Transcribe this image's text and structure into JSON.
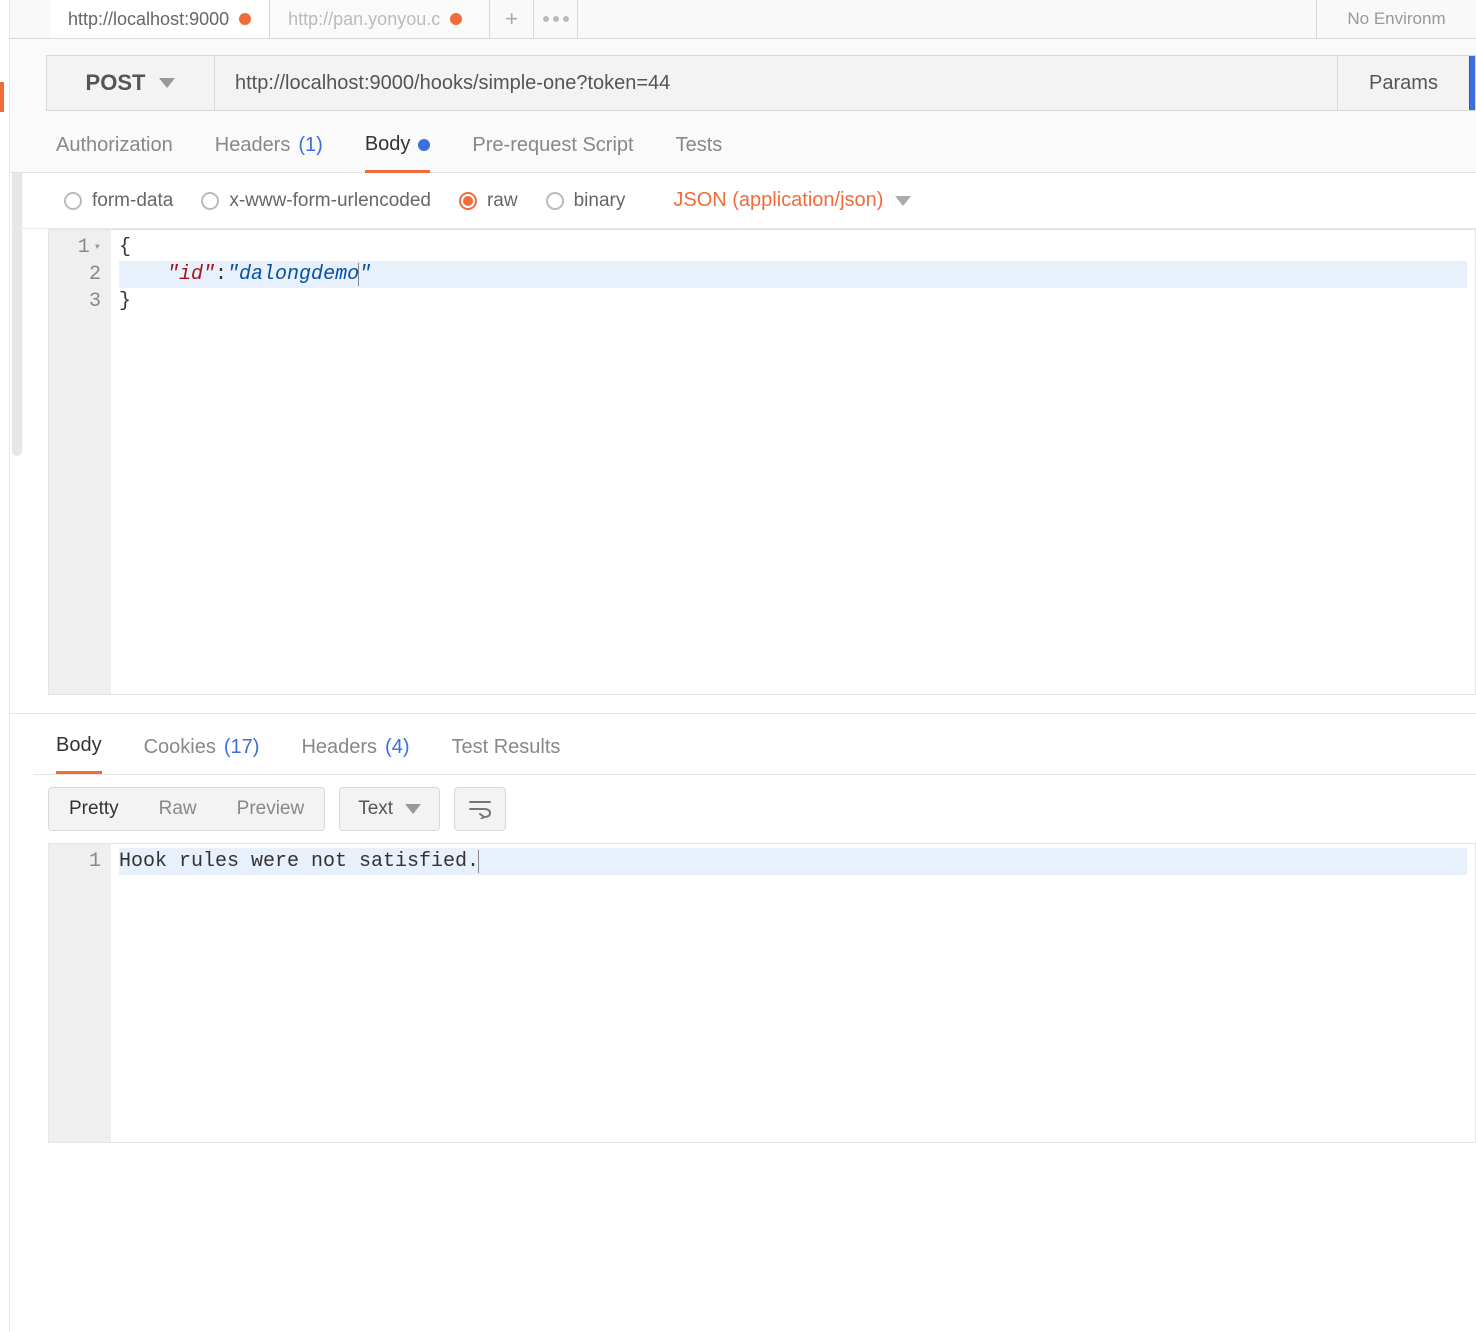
{
  "tabs": [
    {
      "title": "http://localhost:9000",
      "dirty": true,
      "active": true
    },
    {
      "title": "http://pan.yonyou.c",
      "dirty": true,
      "active": false
    }
  ],
  "environment_label": "No Environm",
  "request": {
    "method": "POST",
    "url": "http://localhost:9000/hooks/simple-one?token=44",
    "params_button": "Params"
  },
  "request_tabs": {
    "authorization": "Authorization",
    "headers": "Headers",
    "headers_count": "(1)",
    "body": "Body",
    "prerequest": "Pre-request Script",
    "tests": "Tests",
    "active": "body"
  },
  "body_types": {
    "form_data": "form-data",
    "urlencoded": "x-www-form-urlencoded",
    "raw": "raw",
    "binary": "binary",
    "selected": "raw",
    "content_type": "JSON (application/json)"
  },
  "editor_lines": [
    {
      "n": "1",
      "foldable": true,
      "tokens": [
        {
          "t": "punc",
          "v": "{"
        }
      ]
    },
    {
      "n": "2",
      "hl": true,
      "tokens": [
        {
          "t": "indent",
          "v": "    "
        },
        {
          "t": "key",
          "v": "\"id\""
        },
        {
          "t": "punc",
          "v": ":"
        },
        {
          "t": "str",
          "v": "\"dalongdemo"
        },
        {
          "t": "caret",
          "v": ""
        },
        {
          "t": "str",
          "v": "\""
        }
      ]
    },
    {
      "n": "3",
      "tokens": [
        {
          "t": "punc",
          "v": "}"
        }
      ]
    }
  ],
  "response_tabs": {
    "body": "Body",
    "cookies": "Cookies",
    "cookies_count": "(17)",
    "headers": "Headers",
    "headers_count": "(4)",
    "test_results": "Test Results",
    "active": "body"
  },
  "response_toolbar": {
    "pretty": "Pretty",
    "raw": "Raw",
    "preview": "Preview",
    "active_view": "pretty",
    "lang": "Text"
  },
  "response_lines": [
    {
      "n": "1",
      "hl": true,
      "text": "Hook rules were not satisfied."
    }
  ]
}
